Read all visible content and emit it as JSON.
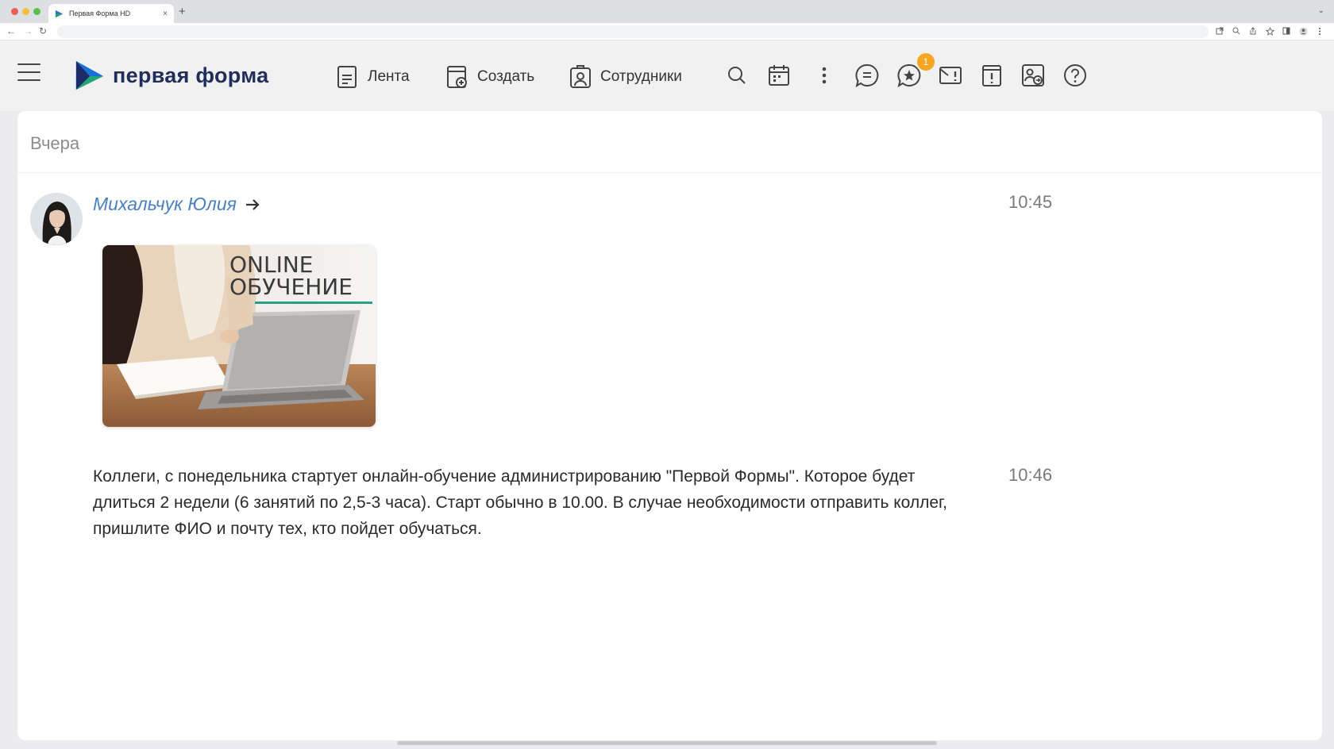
{
  "browser": {
    "tab_title": "Первая Форма HD",
    "tab_close": "×",
    "new_tab": "+",
    "tabs_menu": "⌄",
    "url": "",
    "nav_back": "←",
    "nav_forward": "→",
    "nav_reload": "↻"
  },
  "header": {
    "logo_text": "первая форма",
    "nav": [
      {
        "label": "Лента",
        "icon": "feed-icon"
      },
      {
        "label": "Создать",
        "icon": "create-icon"
      },
      {
        "label": "Сотрудники",
        "icon": "employees-icon"
      }
    ],
    "tools": [
      "search-icon",
      "calendar-icon",
      "more-vertical-icon",
      "chat-icon",
      "favorites-chat-icon",
      "mail-alert-icon",
      "alert-icon",
      "user-transfer-icon",
      "help-icon"
    ],
    "notification_count": "1"
  },
  "feed": {
    "date_group": "Вчера",
    "author": "Михальчук Юлия",
    "messages": [
      {
        "time": "10:45",
        "attachment_caption": [
          "ONLINE",
          "ОБУЧЕНИЕ"
        ]
      },
      {
        "time": "10:46",
        "text": "Коллеги, с понедельника стартует онлайн-обучение администрированию \"Первой Формы\". Которое будет длиться 2 недели (6 занятий по 2,5-3 часа). Старт обычно в 10.00. В случае необходимости отправить коллег, пришлите ФИО и почту тех, кто пойдет обучаться."
      }
    ]
  },
  "colors": {
    "accent": "#4a80c2",
    "badge": "#f5a623",
    "logo_text": "#1f2e5a"
  }
}
